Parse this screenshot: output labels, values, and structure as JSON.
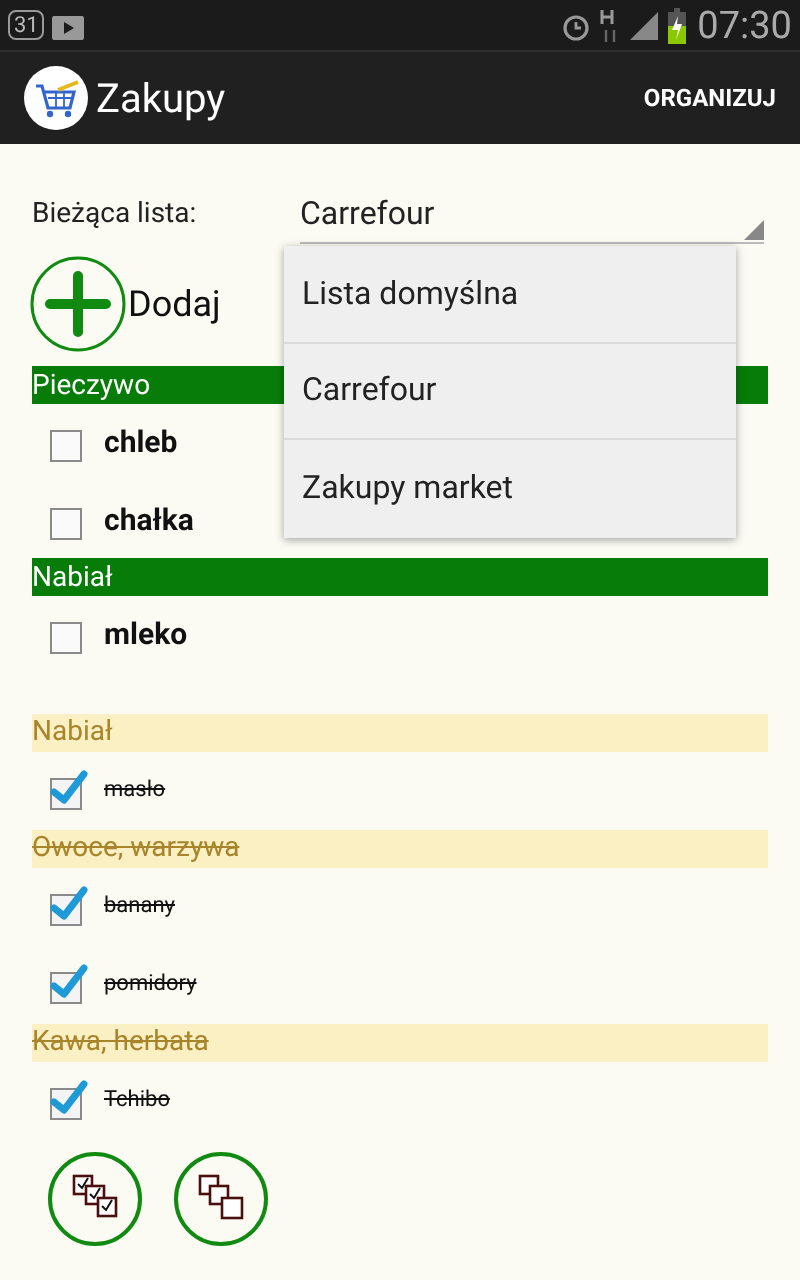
{
  "status_bar": {
    "time": "07:30",
    "notification_count": "31"
  },
  "action_bar": {
    "title": "Zakupy",
    "action": "ORGANIZUJ"
  },
  "current_list": {
    "label": "Bieżąca lista:",
    "value": "Carrefour",
    "expanded": true
  },
  "dropdown": [
    {
      "label": "Lista domyślna"
    },
    {
      "label": "Carrefour"
    },
    {
      "label": "Zakupy market"
    }
  ],
  "add_button": {
    "label": "Dodaj"
  },
  "groups": [
    {
      "name": "Pieczywo",
      "done": false,
      "items": [
        {
          "name": "chleb",
          "checked": false
        },
        {
          "name": "chałka",
          "checked": false
        }
      ]
    },
    {
      "name": "Nabiał",
      "done": false,
      "items": [
        {
          "name": "mleko",
          "checked": false
        }
      ]
    },
    {
      "name": "Nabiał",
      "done": true,
      "items": [
        {
          "name": "masło",
          "checked": true
        }
      ]
    },
    {
      "name": "Owoce, warzywa",
      "done": true,
      "items": [
        {
          "name": "banany",
          "checked": true
        },
        {
          "name": "pomidory",
          "checked": true
        }
      ]
    },
    {
      "name": "Kawa, herbata",
      "done": true,
      "items": [
        {
          "name": "Tchibo",
          "checked": true
        }
      ]
    }
  ]
}
